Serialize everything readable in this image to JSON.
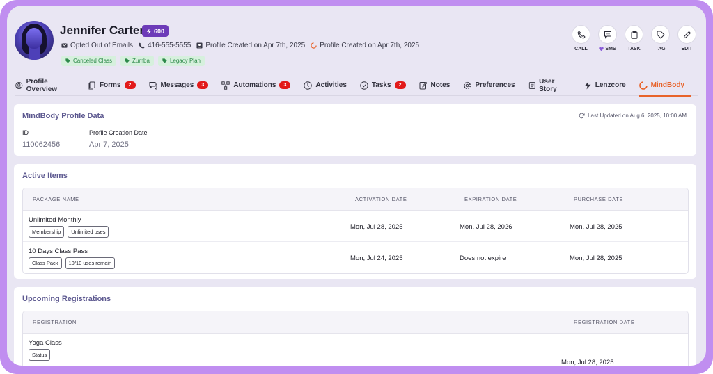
{
  "profile": {
    "name": "Jennifer Carter",
    "score": "600",
    "email_status": "Opted Out of Emails",
    "phone": "416-555-5555",
    "created_1": "Profile Created on Apr 7th, 2025",
    "created_2": "Profile Created on Apr 7th, 2025",
    "tags": [
      "Canceled Class",
      "Zumba",
      "Legacy Plan"
    ]
  },
  "actions": {
    "call": "CALL",
    "sms": "SMS",
    "task": "TASK",
    "tag": "TAG",
    "edit": "EDIT"
  },
  "tabs": [
    {
      "label": "Profile Overview",
      "icon": "user-circle-icon"
    },
    {
      "label": "Forms",
      "badge": "2",
      "icon": "forms-icon"
    },
    {
      "label": "Messages",
      "badge": "3",
      "icon": "chat-icon"
    },
    {
      "label": "Automations",
      "badge": "3",
      "icon": "automation-icon"
    },
    {
      "label": "Activities",
      "icon": "clock-icon"
    },
    {
      "label": "Tasks",
      "badge": "2",
      "icon": "check-circle-icon"
    },
    {
      "label": "Notes",
      "icon": "note-icon"
    },
    {
      "label": "Preferences",
      "icon": "gear-icon"
    },
    {
      "label": "User Story",
      "icon": "book-icon"
    },
    {
      "label": "Lenzcore",
      "icon": "bolt-icon"
    },
    {
      "label": "MindBody",
      "icon": "mindbody-icon",
      "active": true
    }
  ],
  "mindbody_profile": {
    "title": "MindBody Profile Data",
    "last_updated": "Last Updated on Aug 6, 2025, 10:00 AM",
    "id_label": "ID",
    "id_value": "110062456",
    "created_label": "Profile Creation Date",
    "created_value": "Apr 7, 2025"
  },
  "active_items": {
    "title": "Active Items",
    "headers": [
      "PACKAGE NAME",
      "ACTIVATION DATE",
      "EXPIRATION DATE",
      "PURCHASE DATE"
    ],
    "rows": [
      {
        "name": "Unlimited Monthly",
        "pills": [
          "Membership",
          "Unlimited uses"
        ],
        "activation": "Mon, Jul 28, 2025",
        "expiration": "Mon, Jul 28, 2026",
        "purchase": "Mon, Jul 28, 2025"
      },
      {
        "name": "10 Days Class Pass",
        "pills": [
          "Class Pack",
          "10/10 uses remain"
        ],
        "activation": "Mon, Jul 24, 2025",
        "expiration": "Does not expire",
        "purchase": "Mon, Jul 28, 2025"
      }
    ]
  },
  "upcoming": {
    "title": "Upcoming Registrations",
    "headers": [
      "REGISTRATION",
      "REGISTRATION DATE"
    ],
    "rows": [
      {
        "name": "Yoga Class",
        "pill": "Status",
        "date": "Mon, Jul 28, 2025"
      }
    ]
  },
  "colors": {
    "frame": "#c08ef0",
    "background": "#e9e6f3",
    "accent_orange": "#e8632a",
    "badge_red": "#e21a1a",
    "tag_green": "#2e8a4a",
    "card_title": "#5d5990"
  }
}
